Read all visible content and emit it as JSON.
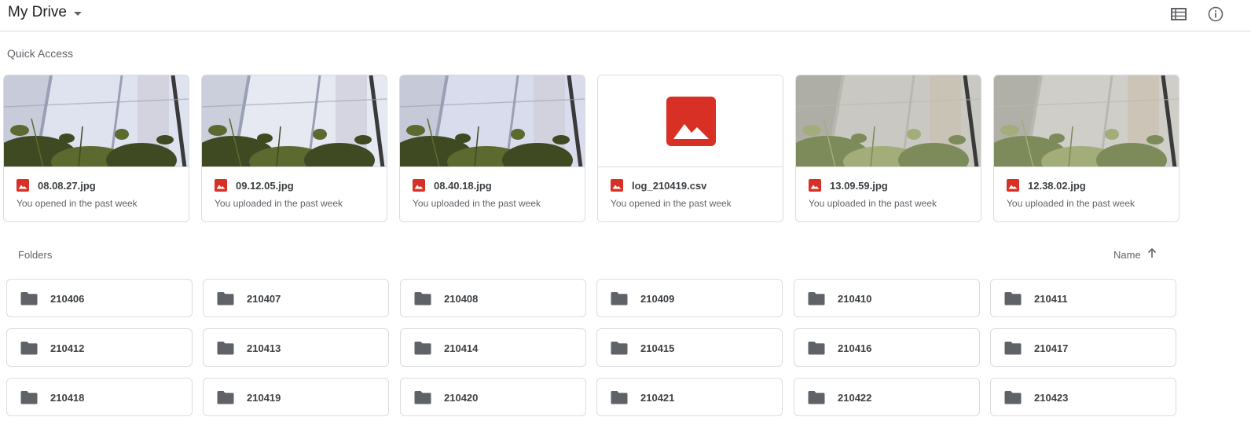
{
  "header": {
    "title": "My Drive",
    "icons": [
      "list-view-icon",
      "info-icon"
    ]
  },
  "quick_access": {
    "title": "Quick Access",
    "items": [
      {
        "name": "08.08.27.jpg",
        "subtitle": "You opened in the past week",
        "thumb": "photo"
      },
      {
        "name": "09.12.05.jpg",
        "subtitle": "You uploaded in the past week",
        "thumb": "photo"
      },
      {
        "name": "08.40.18.jpg",
        "subtitle": "You uploaded in the past week",
        "thumb": "photo"
      },
      {
        "name": "log_210419.csv",
        "subtitle": "You opened in the past week",
        "thumb": "image-icon"
      },
      {
        "name": "13.09.59.jpg",
        "subtitle": "You uploaded in the past week",
        "thumb": "photo"
      },
      {
        "name": "12.38.02.jpg",
        "subtitle": "You uploaded in the past week",
        "thumb": "photo"
      }
    ]
  },
  "folders": {
    "title": "Folders",
    "sort_label": "Name",
    "items": [
      "210406",
      "210407",
      "210408",
      "210409",
      "210410",
      "210411",
      "210412",
      "210413",
      "210414",
      "210415",
      "210416",
      "210417",
      "210418",
      "210419",
      "210420",
      "210421",
      "210422",
      "210423"
    ]
  },
  "colors": {
    "image_red": "#d93025",
    "folder_gray": "#5f6368",
    "border": "#dadce0"
  }
}
